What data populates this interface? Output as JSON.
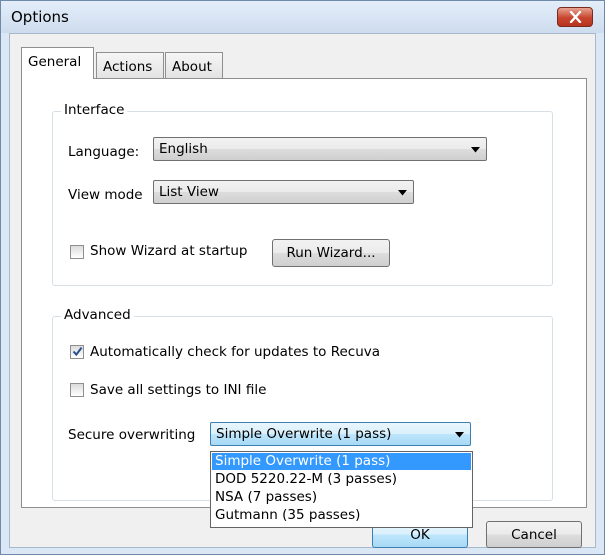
{
  "window": {
    "title": "Options"
  },
  "tabs": [
    {
      "label": "General",
      "active": true
    },
    {
      "label": "Actions",
      "active": false
    },
    {
      "label": "About",
      "active": false
    }
  ],
  "interface": {
    "title": "Interface",
    "language_label": "Language:",
    "language_value": "English",
    "view_mode_label": "View mode",
    "view_mode_value": "List View",
    "show_wizard_label": "Show Wizard at startup",
    "show_wizard_checked": false,
    "run_wizard_label": "Run Wizard..."
  },
  "advanced": {
    "title": "Advanced",
    "auto_update_label": "Automatically check for updates to Recuva",
    "auto_update_checked": true,
    "save_ini_label": "Save all settings to INI file",
    "save_ini_checked": false,
    "secure_overwriting_label": "Secure overwriting",
    "secure_overwriting_value": "Simple Overwrite (1 pass)",
    "secure_overwriting_options": [
      "Simple Overwrite (1 pass)",
      "DOD 5220.22-M (3 passes)",
      "NSA (7 passes)",
      "Gutmann (35 passes)"
    ],
    "selected_option_index": 0
  },
  "footer": {
    "ok_label": "OK",
    "cancel_label": "Cancel"
  },
  "colors": {
    "selection": "#3399ff",
    "close_button": "#c7452e",
    "title_bar": "#dbe7f4"
  },
  "icons": {
    "close": "close-x-icon",
    "dropdown": "chevron-down-icon",
    "check": "checkmark-icon"
  }
}
